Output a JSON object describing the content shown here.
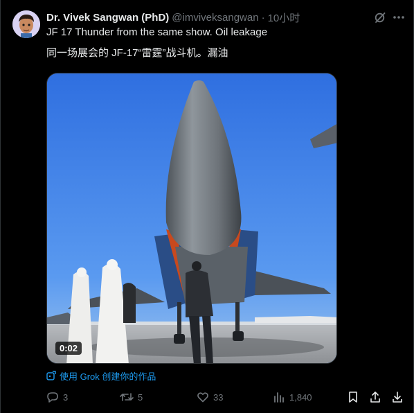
{
  "post": {
    "author_name": "Dr. Vivek Sangwan (PhD)",
    "handle": "@imviveksangwan",
    "separator": "·",
    "time": "10小时",
    "text_line1": "JF 17 Thunder from the same show. Oil leakage",
    "text_line2": "同一场展会的 JF-17“雷霆”战斗机。漏油",
    "video_time": "0:02",
    "grok_link": "使用 Grok 创建你的作品"
  },
  "actions": {
    "replies": "3",
    "reposts": "5",
    "likes": "33",
    "views": "1,840"
  },
  "colors": {
    "background": "#000000",
    "text": "#e7e9ea",
    "muted": "#71767b",
    "link": "#1d9bf0",
    "sky": "#3f7ce4"
  },
  "icons": [
    "avatar",
    "grok-icon",
    "more-icon",
    "reply-icon",
    "repost-icon",
    "like-icon",
    "views-icon",
    "bookmark-icon",
    "share-icon",
    "download-icon",
    "grok-create-icon"
  ]
}
